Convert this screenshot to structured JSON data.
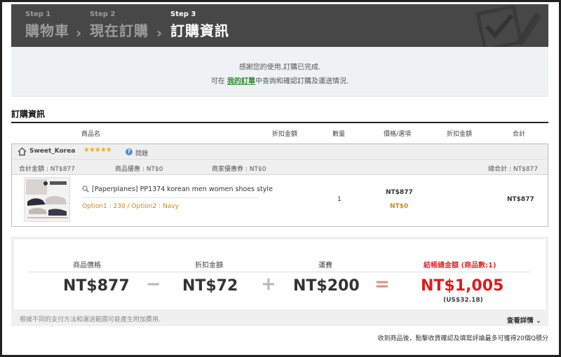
{
  "steps": [
    {
      "num": "Step 1",
      "name": "購物車"
    },
    {
      "num": "Step 2",
      "name": "現在訂購"
    },
    {
      "num": "Step 3",
      "name": "訂購資訊"
    }
  ],
  "notice": {
    "line1": "感謝您的使用,訂購已完成.",
    "line2_prefix": "可在",
    "link": "我的訂單",
    "line2_suffix": "中查詢和確認訂購及運送情況."
  },
  "section_title": "訂購資訊",
  "table_headers": {
    "product": "商品名",
    "discount": "折扣金額",
    "qty": "數量",
    "price_option": "價格/選項",
    "discount2": "折扣金額",
    "total": "合計"
  },
  "store": {
    "name": "Sweet_Korea",
    "rating_stars": "★★★★★",
    "question_label": "問題",
    "sum_total": "合計金額 : NT$877",
    "product_discount": "商品優惠 : NT$0",
    "seller_coupon": "商家優惠券 : NT$0",
    "grand_total": "總合計 : NT$877"
  },
  "product": {
    "name": "[Paperplanes] PP1374 korean men women shoes style",
    "options": "Option1 : 230 / Option2 : Navy",
    "qty": "1",
    "price": "NT$877",
    "discount": "NT$0",
    "total": "NT$877"
  },
  "totals": {
    "price_label": "商品價格",
    "price_value": "NT$877",
    "discount_label": "折扣金額",
    "discount_value": "NT$72",
    "shipping_label": "運費",
    "shipping_value": "NT$200",
    "grand_label": "結帳總金額 (商品數:1)",
    "grand_value": "NT$1,005",
    "grand_usd": "(US$32.18)",
    "op_minus": "−",
    "op_plus": "+",
    "op_equals": "=",
    "note": "根據不同的支付方法和運送範圍可能產生附加費用.",
    "details_label": "查看詳情 ⌄"
  },
  "footer_note": "收到商品後，點擊收貨確認及填寫評論最多可獲得20個Q積分",
  "colors": {
    "header_bg": "#474747",
    "accent_green": "#2c8a2c",
    "grand_red": "#e01a1a",
    "option_orange": "#c98a1a"
  }
}
